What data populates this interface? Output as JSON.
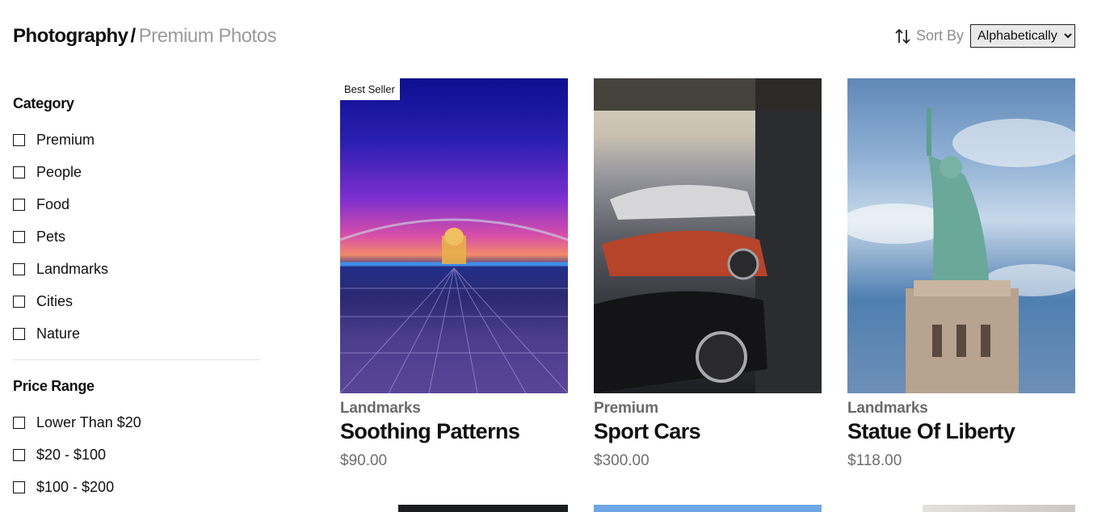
{
  "breadcrumb": {
    "root": "Photography",
    "separator": "/",
    "current": "Premium Photos"
  },
  "sort": {
    "label": "Sort By",
    "selected": "Alphabetically",
    "icon": "sort-arrows-icon"
  },
  "filters": {
    "category": {
      "heading": "Category",
      "items": [
        "Premium",
        "People",
        "Food",
        "Pets",
        "Landmarks",
        "Cities",
        "Nature"
      ]
    },
    "price": {
      "heading": "Price Range",
      "items": [
        "Lower Than $20",
        "$20 - $100",
        "$100 - $200"
      ]
    }
  },
  "products": [
    {
      "badge": "Best Seller",
      "category": "Landmarks",
      "title": "Soothing Patterns",
      "price": "$90.00"
    },
    {
      "category": "Premium",
      "title": "Sport Cars",
      "price": "$300.00"
    },
    {
      "category": "Landmarks",
      "title": "Statue Of Liberty",
      "price": "$118.00"
    }
  ],
  "colors": {
    "muted": "#9a9a9a",
    "text": "#111111",
    "select_bg": "#e9e9e9"
  }
}
